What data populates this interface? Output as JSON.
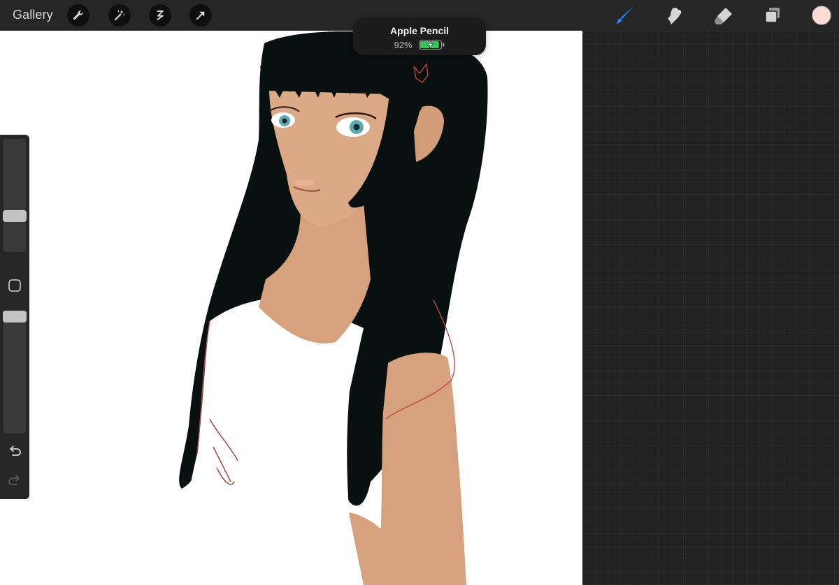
{
  "topbar": {
    "gallery_label": "Gallery",
    "left_tools": [
      {
        "name": "actions-wrench-icon"
      },
      {
        "name": "adjustments-wand-icon"
      },
      {
        "name": "selection-icon"
      },
      {
        "name": "transform-arrow-icon"
      }
    ],
    "right_tools": [
      {
        "name": "brush-icon",
        "active": true
      },
      {
        "name": "smudge-icon",
        "active": false
      },
      {
        "name": "eraser-icon",
        "active": false
      },
      {
        "name": "layers-icon",
        "active": false
      }
    ],
    "current_color": "#f9dcd2",
    "accent_color": "#1a84ff"
  },
  "pencil_popup": {
    "title": "Apple Pencil",
    "battery_text": "92%",
    "battery_level": 0.92,
    "battery_color": "#33c759"
  },
  "sidebar": {
    "brush_size_level": 0.3,
    "opacity_level": 1.0,
    "icons": [
      "modify-square-icon",
      "undo-icon",
      "redo-icon"
    ]
  }
}
